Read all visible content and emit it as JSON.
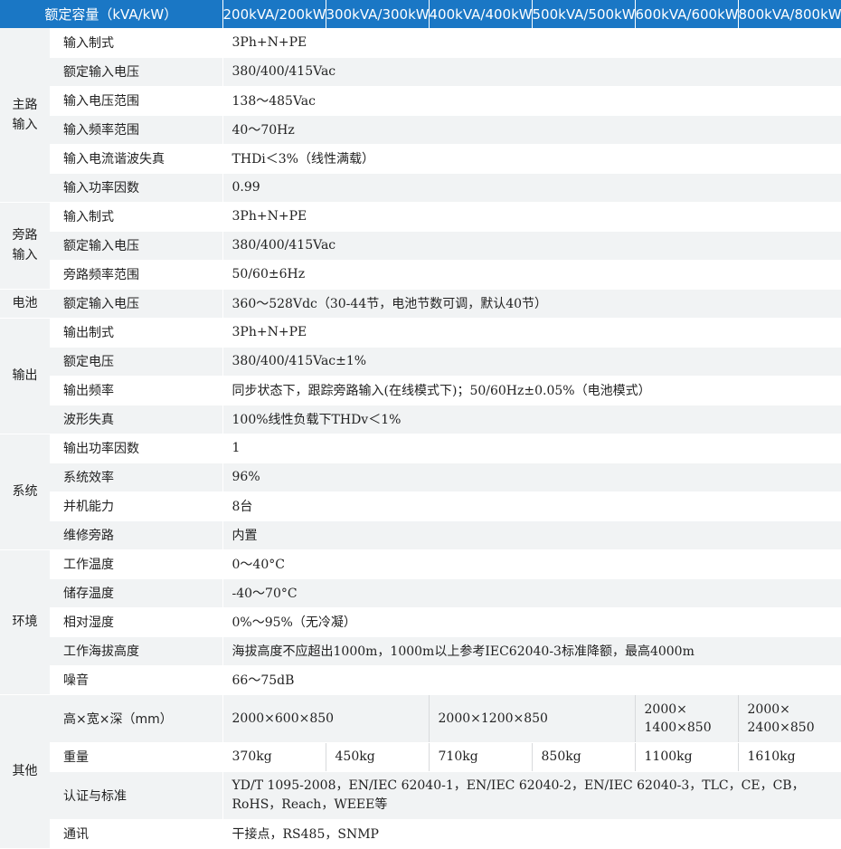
{
  "header": {
    "title": "额定容量（kVA/kW）",
    "models": [
      "200kVA/200kW",
      "300kVA/300kW",
      "400kVA/400kW",
      "500kVA/500kW",
      "600kVA/600kW",
      "800kVA/800kW"
    ]
  },
  "main_input": {
    "label_line1": "主路",
    "label_line2": "输入",
    "rows": [
      {
        "param": "输入制式",
        "value": "3Ph+N+PE"
      },
      {
        "param": "额定输入电压",
        "value": "380/400/415Vac"
      },
      {
        "param": "输入电压范围",
        "value": "138～485Vac"
      },
      {
        "param": "输入频率范围",
        "value": "40～70Hz"
      },
      {
        "param": "输入电流谐波失真",
        "value": "THDi＜3%（线性满载）"
      },
      {
        "param": "输入功率因数",
        "value": "0.99"
      }
    ]
  },
  "bypass_input": {
    "label_line1": "旁路",
    "label_line2": "输入",
    "rows": [
      {
        "param": "输入制式",
        "value": "3Ph+N+PE"
      },
      {
        "param": "额定输入电压",
        "value": "380/400/415Vac"
      },
      {
        "param": "旁路频率范围",
        "value": "50/60±6Hz"
      }
    ]
  },
  "battery": {
    "label": "电池",
    "rows": [
      {
        "param": "额定输入电压",
        "value": "360～528Vdc（30-44节，电池节数可调，默认40节）"
      }
    ]
  },
  "output": {
    "label": "输出",
    "rows": [
      {
        "param": "输出制式",
        "value": "3Ph+N+PE"
      },
      {
        "param": "额定电压",
        "value": "380/400/415Vac±1%"
      },
      {
        "param": "输出频率",
        "value": "同步状态下，跟踪旁路输入(在线模式下)；50/60Hz±0.05%（电池模式）"
      },
      {
        "param": "波形失真",
        "value": "100%线性负载下THDv＜1%"
      }
    ]
  },
  "system": {
    "label": "系统",
    "rows": [
      {
        "param": "输出功率因数",
        "value": "1"
      },
      {
        "param": "系统效率",
        "value": "96%"
      },
      {
        "param": "并机能力",
        "value": "8台"
      },
      {
        "param": "维修旁路",
        "value": "内置"
      }
    ]
  },
  "environment": {
    "label": "环境",
    "rows": [
      {
        "param": "工作温度",
        "value": "0～40°C"
      },
      {
        "param": "储存温度",
        "value": "-40～70°C"
      },
      {
        "param": "相对湿度",
        "value": "0%～95%（无冷凝）"
      },
      {
        "param": "工作海拔高度",
        "value": "海拔高度不应超出1000m，1000m以上参考IEC62040-3标准降额，最高4000m"
      },
      {
        "param": "噪音",
        "value": "66～75dB"
      }
    ]
  },
  "other": {
    "label": "其他",
    "dimensions": {
      "param": "高×宽×深（mm）",
      "v1": "2000×600×850",
      "v2": "2000×1200×850",
      "v3_line1": "2000×",
      "v3_line2": "1400×850",
      "v4_line1": "2000×",
      "v4_line2": "2400×850"
    },
    "weight": {
      "param": "重量",
      "values": [
        "370kg",
        "450kg",
        "710kg",
        "850kg",
        "1100kg",
        "1610kg"
      ]
    },
    "cert": {
      "param": "认证与标准",
      "line1": "YD/T 1095-2008，EN/IEC 62040-1，EN/IEC 62040-2，EN/IEC 62040-3，TLC，CE，CB，",
      "line2": "RoHS，Reach，WEEE等"
    },
    "comm": {
      "param": "通讯",
      "value": "干接点，RS485，SNMP"
    }
  }
}
